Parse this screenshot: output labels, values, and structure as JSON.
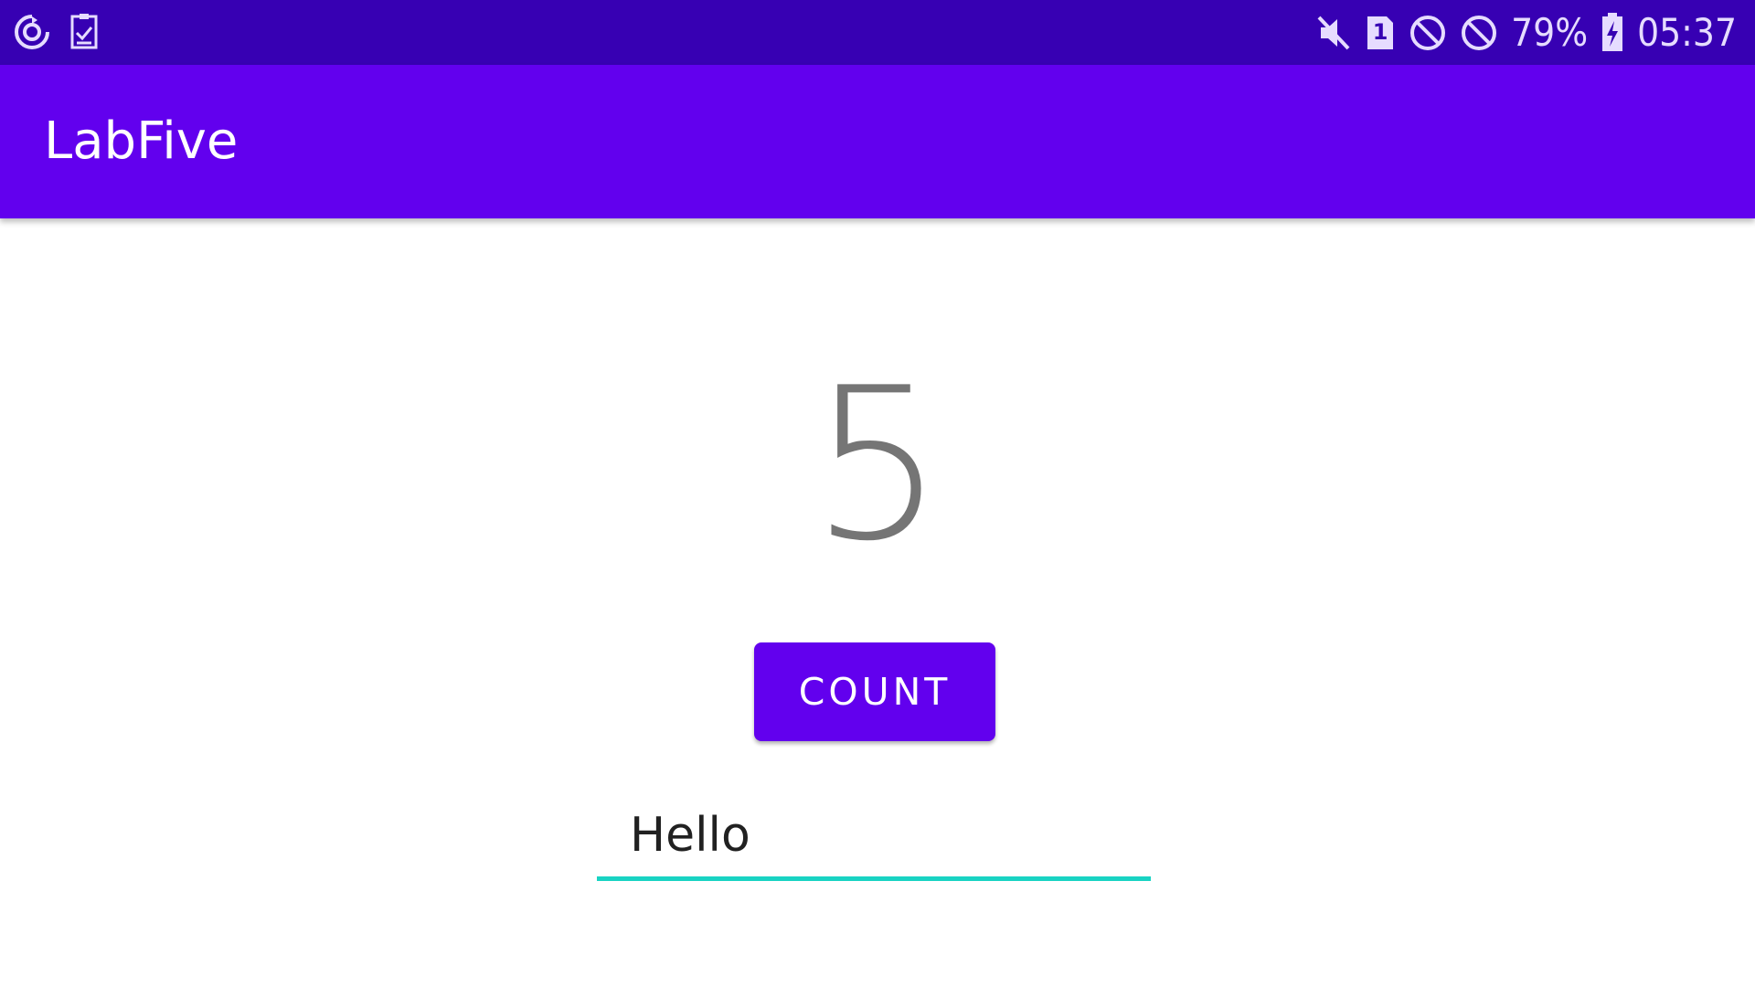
{
  "status_bar": {
    "battery_percent": "79%",
    "time": "05:37",
    "sim_slot": "1",
    "icons": [
      "sync-icon",
      "task-checklist-icon",
      "mute-icon",
      "sim-card-icon",
      "do-not-disturb-icon",
      "blocked-icon",
      "battery-charging-icon"
    ],
    "background_color": "#3700b3"
  },
  "app_bar": {
    "title": "LabFive",
    "background_color": "#6200ee"
  },
  "main": {
    "count_value": "5",
    "count_button_label": "COUNT",
    "text_field_value": "Hello",
    "accent_color": "#18d3c3"
  }
}
